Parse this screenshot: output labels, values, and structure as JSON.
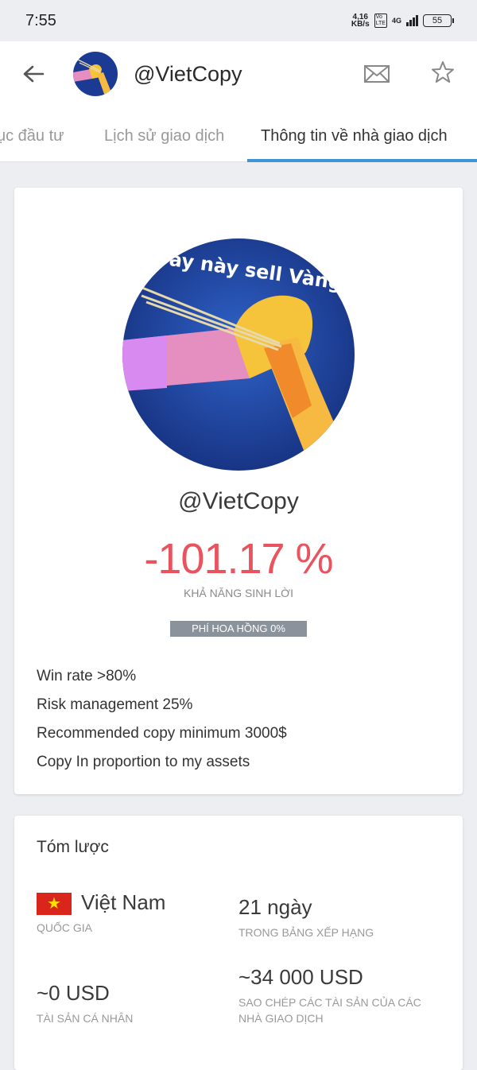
{
  "status_bar": {
    "time": "7:55",
    "net_speed_value": "4,16",
    "net_speed_unit": "KB/s",
    "volte_top": "Vo",
    "volte_bottom": "LTE",
    "network": "4G",
    "battery": "55"
  },
  "header": {
    "username": "@VietCopy",
    "icons": {
      "back": "arrow-left-icon",
      "mail": "envelope-icon",
      "favorite": "star-icon"
    }
  },
  "tabs": [
    {
      "label": "ục đầu tư",
      "active": false
    },
    {
      "label": "Lịch sử giao dịch",
      "active": false
    },
    {
      "label": "Thông tin về nhà giao dịch",
      "active": true
    }
  ],
  "profile": {
    "name": "@VietCopy",
    "profitability": "-101.17 %",
    "profitability_label": "KHẢ NĂNG SINH LỜI",
    "commission_badge": "PHÍ HOA HỒNG 0%",
    "avatar_caption": "ay này sell Vàng",
    "bio_lines": [
      "Win rate >80%",
      "Risk management 25%",
      "Recommended copy minimum 3000$",
      "Copy In proportion to my assets"
    ]
  },
  "summary": {
    "title": "Tóm lược",
    "stats": [
      {
        "value": "Việt Nam",
        "label": "QUỐC GIA",
        "flag": "vietnam-flag-icon"
      },
      {
        "value": "21 ngày",
        "label": "TRONG BẢNG XẾP HẠNG"
      },
      {
        "value": "~0 USD",
        "label": "TÀI SẢN CÁ NHÂN"
      },
      {
        "value": "~34 000 USD",
        "label": "SAO CHÉP CÁC TÀI SẢN CỦA CÁC NHÀ GIAO DỊCH"
      }
    ]
  },
  "colors": {
    "accent": "#3f94d6",
    "negative": "#e8535e",
    "badge": "#8a929c"
  }
}
